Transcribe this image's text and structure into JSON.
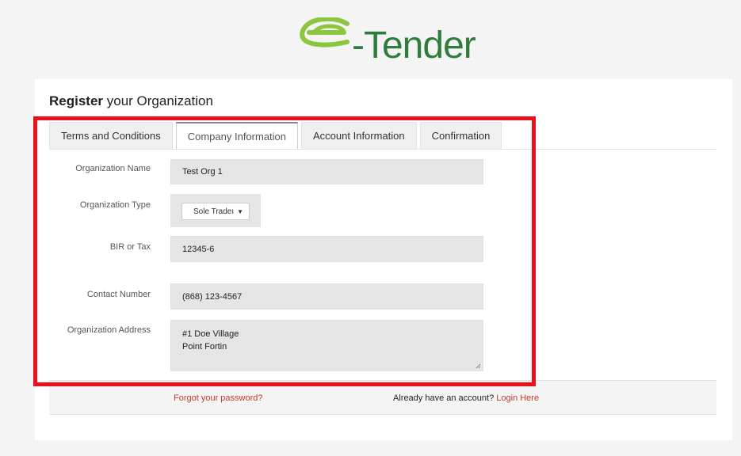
{
  "logo": {
    "icon": "e-leaf-logo-icon",
    "text": "-Tender",
    "color": "#2f7d3c"
  },
  "heading": {
    "bold": "Register",
    "rest": " your Organization"
  },
  "tabs": [
    {
      "label": "Terms and Conditions",
      "active": false
    },
    {
      "label": "Company Information",
      "active": true
    },
    {
      "label": "Account Information",
      "active": false
    },
    {
      "label": "Confirmation",
      "active": false
    }
  ],
  "form": {
    "org_name": {
      "label": "Organization Name",
      "value": "Test Org 1"
    },
    "org_type": {
      "label": "Organization Type",
      "value": "Sole Tradeı"
    },
    "tax": {
      "label": "BIR or Tax",
      "value": "12345-6"
    },
    "contact": {
      "label": "Contact Number",
      "value": "(868) 123-4567"
    },
    "address": {
      "label": "Organization Address",
      "line1": "#1 Doe Village",
      "line2": "Point Fortin"
    }
  },
  "footer": {
    "forgot": "Forgot your password?",
    "already": "Already have an account? ",
    "login": "Login Here"
  },
  "colors": {
    "highlight": "#e8131a",
    "link": "#c43c2c",
    "brand": "#2f7d3c"
  }
}
